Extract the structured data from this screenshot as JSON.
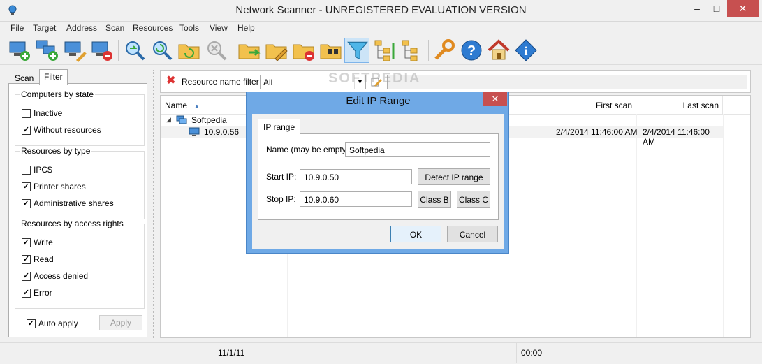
{
  "window": {
    "title": "Network Scanner - UNREGISTERED EVALUATION VERSION"
  },
  "menu": [
    "File",
    "Target",
    "Address",
    "Scan",
    "Resources",
    "Tools",
    "View",
    "Help"
  ],
  "toolbar": {
    "buttons": [
      "add-computer",
      "add-range",
      "edit-computer",
      "delete-computer",
      "scan",
      "rescan",
      "scan-folder",
      "stop-scan",
      "open-folder",
      "edit-folder",
      "remove-folder",
      "search-folder",
      "filter",
      "tree-expand",
      "tree-collapse",
      "options",
      "help",
      "home",
      "info"
    ]
  },
  "left_panel": {
    "tabs": [
      "Scan",
      "Filter"
    ],
    "groups": [
      {
        "title": "Computers by state",
        "items": [
          {
            "label": "Inactive",
            "checked": false
          },
          {
            "label": "Without resources",
            "checked": true
          }
        ]
      },
      {
        "title": "Resources by type",
        "items": [
          {
            "label": "IPC$",
            "checked": false
          },
          {
            "label": "Printer shares",
            "checked": true
          },
          {
            "label": "Administrative shares",
            "checked": true
          }
        ]
      },
      {
        "title": "Resources by access rights",
        "items": [
          {
            "label": "Write",
            "checked": true
          },
          {
            "label": "Read",
            "checked": true
          },
          {
            "label": "Access denied",
            "checked": true
          },
          {
            "label": "Error",
            "checked": true
          }
        ]
      }
    ],
    "auto_apply": {
      "label": "Auto apply",
      "checked": true
    },
    "apply_button": "Apply"
  },
  "filter_bar": {
    "label": "Resource name filter",
    "select_value": "All"
  },
  "grid": {
    "columns": [
      "Name",
      "First scan",
      "Last scan"
    ],
    "rows": [
      {
        "name": "Softpedia",
        "first": "",
        "last": ""
      },
      {
        "name": "10.9.0.56",
        "first": "2/4/2014 11:46:00 AM",
        "last": "2/4/2014 11:46:00 AM"
      }
    ]
  },
  "status": {
    "cell2": "11/1/11",
    "cell3": "00:00"
  },
  "dialog": {
    "title": "Edit IP Range",
    "tab": "IP range",
    "name_label": "Name (may be empty):",
    "name_value": "Softpedia",
    "start_label": "Start IP:",
    "start_value": "10.9.0.50",
    "stop_label": "Stop IP:",
    "stop_value": "10.9.0.60",
    "detect_button": "Detect IP range",
    "class_b_button": "Class B",
    "class_c_button": "Class C",
    "ok_button": "OK",
    "cancel_button": "Cancel"
  },
  "watermark": "SOFTPEDIA",
  "colors": {
    "accent": "#6fa9e6",
    "close": "#c75050",
    "selection": "#cce4f7"
  }
}
